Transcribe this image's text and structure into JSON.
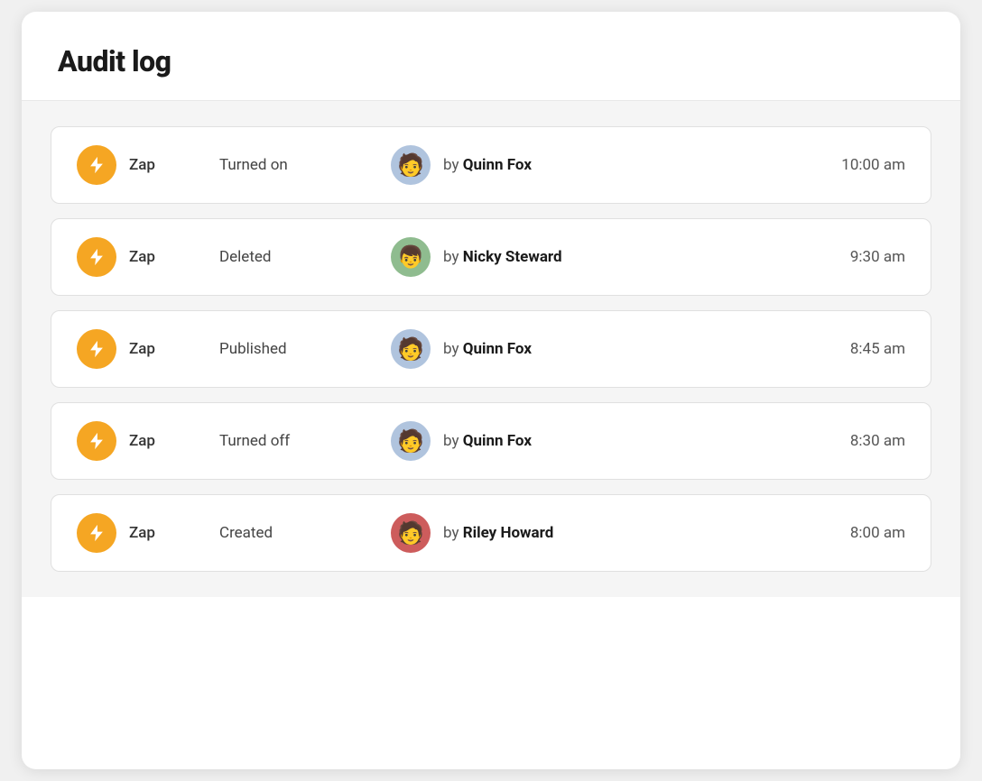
{
  "page": {
    "title": "Audit log"
  },
  "entries": [
    {
      "id": 1,
      "type": "Zap",
      "action": "Turned on",
      "by_label": "by",
      "user": "Quinn Fox",
      "time": "10:00 am",
      "avatar_class": "avatar-quinn-1",
      "avatar_emoji": "🧑"
    },
    {
      "id": 2,
      "type": "Zap",
      "action": "Deleted",
      "by_label": "by",
      "user": "Nicky Steward",
      "time": "9:30 am",
      "avatar_class": "avatar-nicky",
      "avatar_emoji": "👦"
    },
    {
      "id": 3,
      "type": "Zap",
      "action": "Published",
      "by_label": "by",
      "user": "Quinn Fox",
      "time": "8:45 am",
      "avatar_class": "avatar-quinn-2",
      "avatar_emoji": "🧑"
    },
    {
      "id": 4,
      "type": "Zap",
      "action": "Turned off",
      "by_label": "by",
      "user": "Quinn Fox",
      "time": "8:30 am",
      "avatar_class": "avatar-quinn-3",
      "avatar_emoji": "🧑"
    },
    {
      "id": 5,
      "type": "Zap",
      "action": "Created",
      "by_label": "by",
      "user": "Riley Howard",
      "time": "8:00 am",
      "avatar_class": "avatar-riley",
      "avatar_emoji": "🧑"
    }
  ]
}
